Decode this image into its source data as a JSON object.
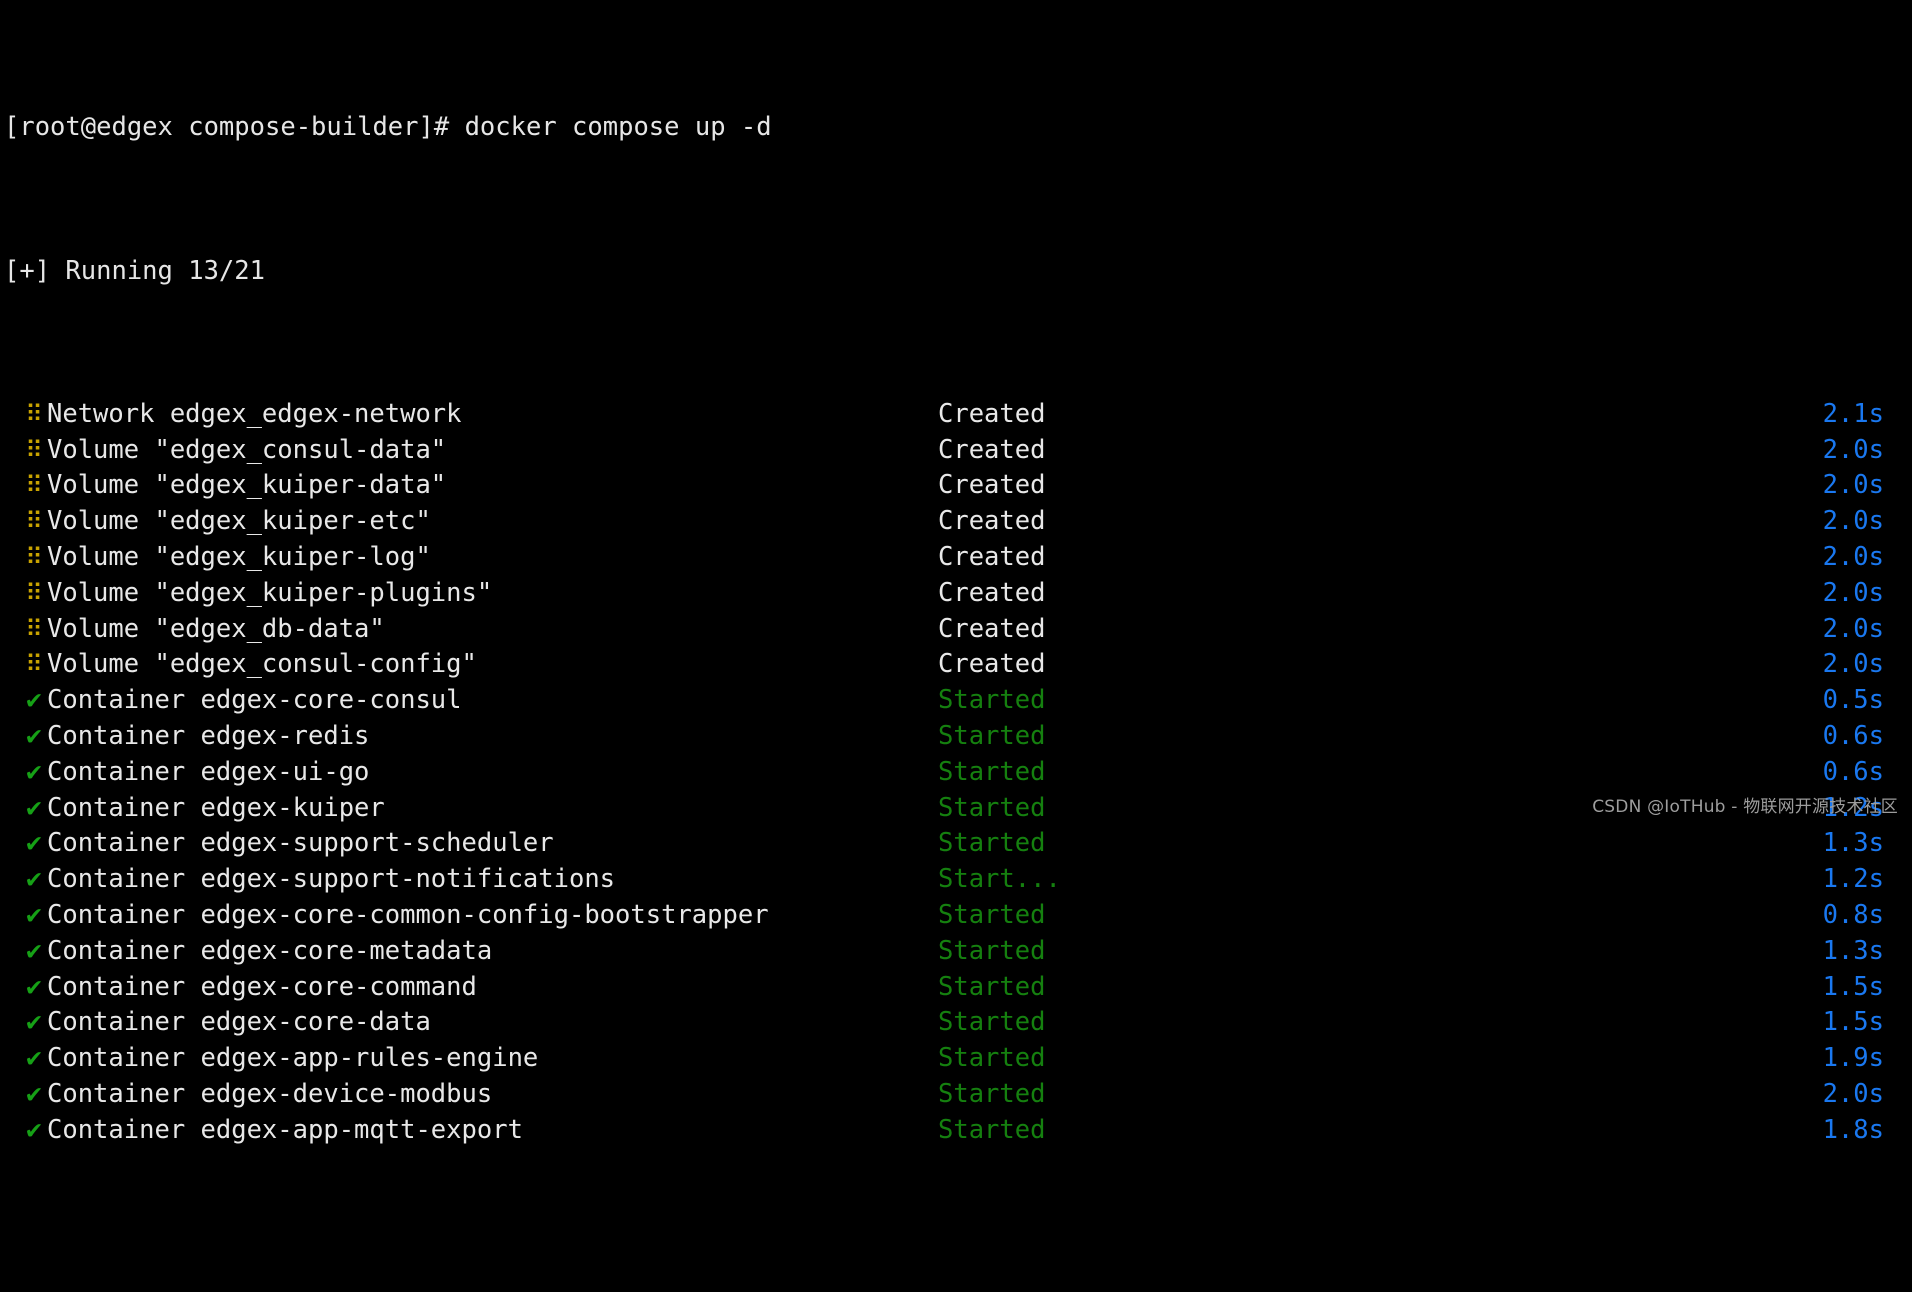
{
  "terminal": {
    "prompt": "[root@edgex compose-builder]# docker compose up -d",
    "running_header": "[+] Running 13/21",
    "markers": {
      "pending": "⠿",
      "done": "✔"
    },
    "colors": {
      "background": "#000000",
      "foreground": "#e8e8e8",
      "marker_pending": "#c9a300",
      "marker_done": "#16a016",
      "status_started": "#15800f",
      "status_created": "#e8e8e8",
      "time": "#1a78f0",
      "watermark": "#9d9d9d"
    },
    "rows": [
      {
        "marker": "pending",
        "name": "Network edgex_edgex-network",
        "status": "Created",
        "status_kind": "created",
        "time": "2.1s"
      },
      {
        "marker": "pending",
        "name": "Volume \"edgex_consul-data\"",
        "status": "Created",
        "status_kind": "created",
        "time": "2.0s"
      },
      {
        "marker": "pending",
        "name": "Volume \"edgex_kuiper-data\"",
        "status": "Created",
        "status_kind": "created",
        "time": "2.0s"
      },
      {
        "marker": "pending",
        "name": "Volume \"edgex_kuiper-etc\"",
        "status": "Created",
        "status_kind": "created",
        "time": "2.0s"
      },
      {
        "marker": "pending",
        "name": "Volume \"edgex_kuiper-log\"",
        "status": "Created",
        "status_kind": "created",
        "time": "2.0s"
      },
      {
        "marker": "pending",
        "name": "Volume \"edgex_kuiper-plugins\"",
        "status": "Created",
        "status_kind": "created",
        "time": "2.0s"
      },
      {
        "marker": "pending",
        "name": "Volume \"edgex_db-data\"",
        "status": "Created",
        "status_kind": "created",
        "time": "2.0s"
      },
      {
        "marker": "pending",
        "name": "Volume \"edgex_consul-config\"",
        "status": "Created",
        "status_kind": "created",
        "time": "2.0s"
      },
      {
        "marker": "done",
        "name": "Container edgex-core-consul",
        "status": "Started",
        "status_kind": "started",
        "time": "0.5s"
      },
      {
        "marker": "done",
        "name": "Container edgex-redis",
        "status": "Started",
        "status_kind": "started",
        "time": "0.6s"
      },
      {
        "marker": "done",
        "name": "Container edgex-ui-go",
        "status": "Started",
        "status_kind": "started",
        "time": "0.6s"
      },
      {
        "marker": "done",
        "name": "Container edgex-kuiper",
        "status": "Started",
        "status_kind": "started",
        "time": "1.2s"
      },
      {
        "marker": "done",
        "name": "Container edgex-support-scheduler",
        "status": "Started",
        "status_kind": "started",
        "time": "1.3s"
      },
      {
        "marker": "done",
        "name": "Container edgex-support-notifications",
        "status": "Start...",
        "status_kind": "started",
        "time": "1.2s"
      },
      {
        "marker": "done",
        "name": "Container edgex-core-common-config-bootstrapper",
        "status": "Started",
        "status_kind": "started",
        "time": "0.8s"
      },
      {
        "marker": "done",
        "name": "Container edgex-core-metadata",
        "status": "Started",
        "status_kind": "started",
        "time": "1.3s"
      },
      {
        "marker": "done",
        "name": "Container edgex-core-command",
        "status": "Started",
        "status_kind": "started",
        "time": "1.5s"
      },
      {
        "marker": "done",
        "name": "Container edgex-core-data",
        "status": "Started",
        "status_kind": "started",
        "time": "1.5s"
      },
      {
        "marker": "done",
        "name": "Container edgex-app-rules-engine",
        "status": "Started",
        "status_kind": "started",
        "time": "1.9s"
      },
      {
        "marker": "done",
        "name": "Container edgex-device-modbus",
        "status": "Started",
        "status_kind": "started",
        "time": "2.0s"
      },
      {
        "marker": "done",
        "name": "Container edgex-app-mqtt-export",
        "status": "Started",
        "status_kind": "started",
        "time": "1.8s"
      }
    ]
  },
  "watermark": {
    "text": "CSDN @IoTHub - 物联网开源技术社区"
  }
}
